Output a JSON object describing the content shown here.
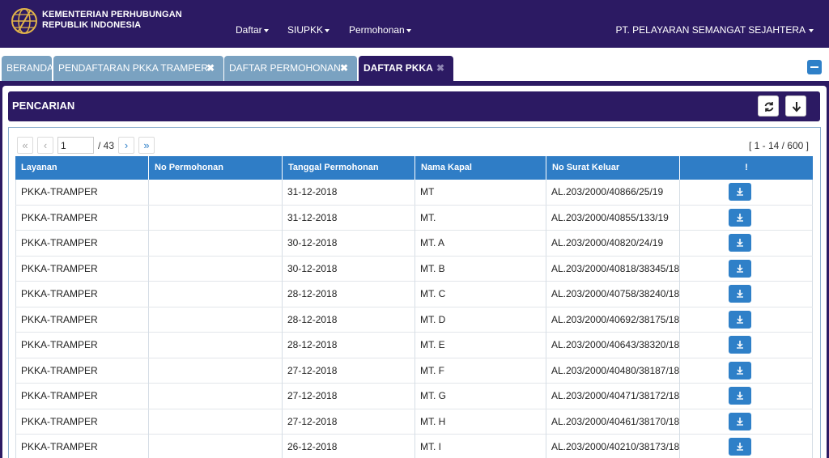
{
  "header": {
    "org_line1": "KEMENTERIAN PERHUBUNGAN",
    "org_line2": "REPUBLIK INDONESIA",
    "nav": [
      {
        "label": "Daftar"
      },
      {
        "label": "SIUPKK"
      },
      {
        "label": "Permohonan"
      }
    ],
    "company": "PT. PELAYARAN SEMANGAT SEJAHTERA"
  },
  "tabs": [
    {
      "label": "BERANDA",
      "closable": false,
      "active": false
    },
    {
      "label": "PENDAFTARAN PKKA TRAMPER",
      "closable": true,
      "active": false
    },
    {
      "label": "DAFTAR PERMOHONAN",
      "closable": true,
      "active": false
    },
    {
      "label": "DAFTAR PKKA",
      "closable": true,
      "active": true
    }
  ],
  "search": {
    "title": "PENCARIAN",
    "refresh_icon": "refresh-icon",
    "download_icon": "arrow-down-icon"
  },
  "pager": {
    "page": "1",
    "total": "/ 43",
    "range": "[ 1 - 14 / 600 ]",
    "first": "«",
    "prev": "‹",
    "next": "›",
    "last": "»"
  },
  "table": {
    "columns": [
      "Layanan",
      "No Permohonan",
      "Tanggal Permohonan",
      "Nama Kapal",
      "No Surat Keluar",
      "!"
    ],
    "rows": [
      {
        "layanan": "PKKA-TRAMPER",
        "no_permohonan": "",
        "tanggal": "31-12-2018",
        "kapal": "MT",
        "surat": "AL.203/2000/40866/25/19"
      },
      {
        "layanan": "PKKA-TRAMPER",
        "no_permohonan": "",
        "tanggal": "31-12-2018",
        "kapal": "MT.",
        "surat": "AL.203/2000/40855/133/19"
      },
      {
        "layanan": "PKKA-TRAMPER",
        "no_permohonan": "",
        "tanggal": "30-12-2018",
        "kapal": "MT. A",
        "surat": "AL.203/2000/40820/24/19"
      },
      {
        "layanan": "PKKA-TRAMPER",
        "no_permohonan": "",
        "tanggal": "30-12-2018",
        "kapal": "MT. B",
        "surat": "AL.203/2000/40818/38345/18"
      },
      {
        "layanan": "PKKA-TRAMPER",
        "no_permohonan": "",
        "tanggal": "28-12-2018",
        "kapal": "MT. C",
        "surat": "AL.203/2000/40758/38240/18"
      },
      {
        "layanan": "PKKA-TRAMPER",
        "no_permohonan": "",
        "tanggal": "28-12-2018",
        "kapal": "MT. D",
        "surat": "AL.203/2000/40692/38175/18"
      },
      {
        "layanan": "PKKA-TRAMPER",
        "no_permohonan": "",
        "tanggal": "28-12-2018",
        "kapal": "MT. E",
        "surat": "AL.203/2000/40643/38320/18"
      },
      {
        "layanan": "PKKA-TRAMPER",
        "no_permohonan": "",
        "tanggal": "27-12-2018",
        "kapal": "MT. F",
        "surat": "AL.203/2000/40480/38187/18"
      },
      {
        "layanan": "PKKA-TRAMPER",
        "no_permohonan": "",
        "tanggal": "27-12-2018",
        "kapal": "MT. G",
        "surat": "AL.203/2000/40471/38172/18"
      },
      {
        "layanan": "PKKA-TRAMPER",
        "no_permohonan": "",
        "tanggal": "27-12-2018",
        "kapal": "MT. H",
        "surat": "AL.203/2000/40461/38170/18"
      },
      {
        "layanan": "PKKA-TRAMPER",
        "no_permohonan": "",
        "tanggal": "26-12-2018",
        "kapal": "MT. I",
        "surat": "AL.203/2000/40210/38173/18"
      }
    ]
  },
  "colors": {
    "primary": "#2c1a63",
    "accent": "#2f80c8",
    "tab_inactive": "#7aa2c1"
  }
}
